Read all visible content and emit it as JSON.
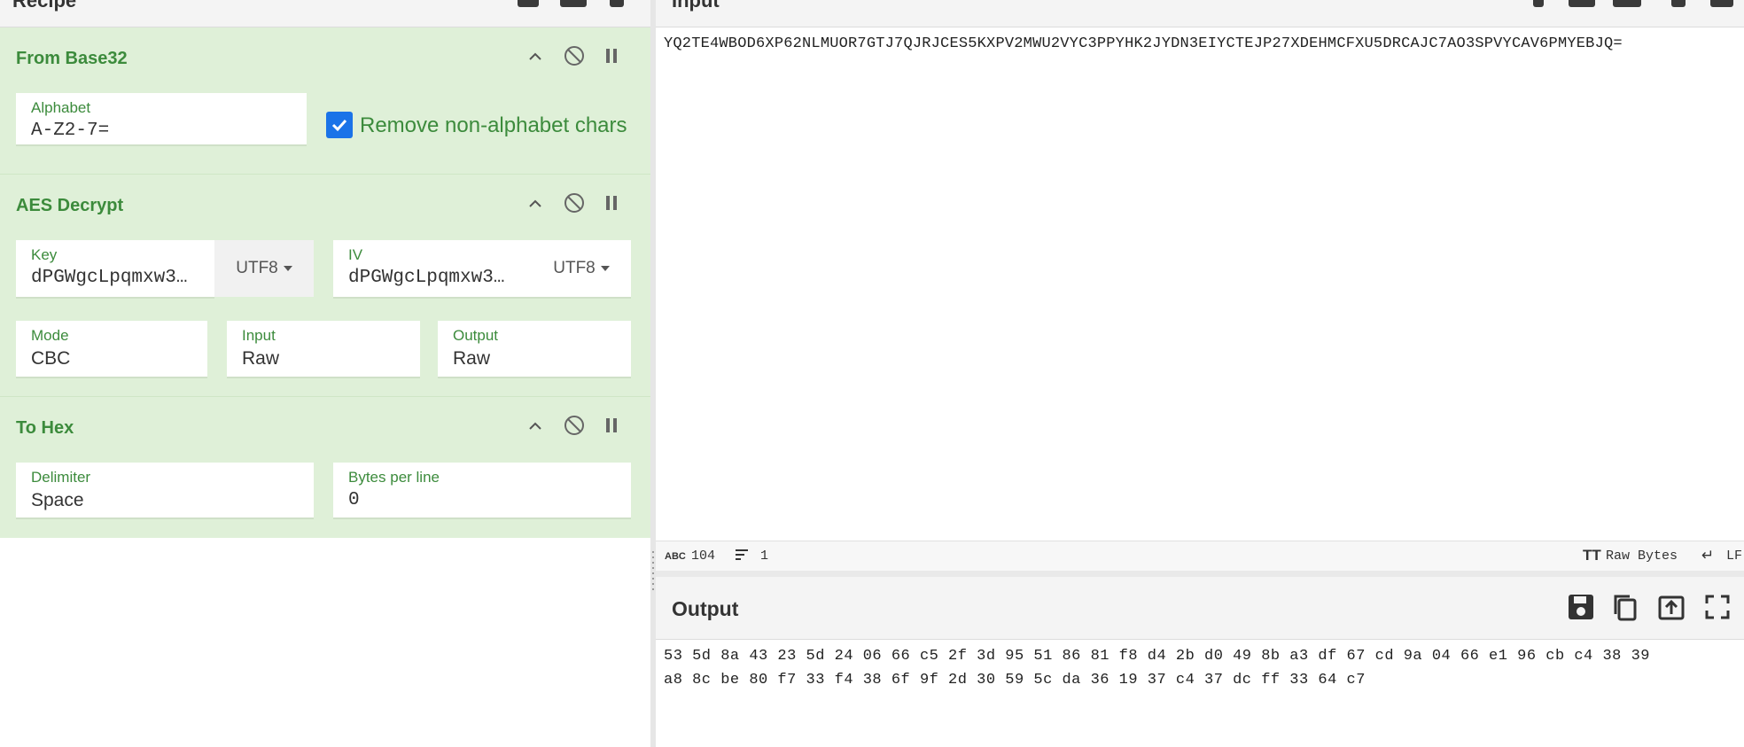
{
  "recipe": {
    "title": "Recipe",
    "operations": [
      {
        "name": "From Base32",
        "alphabet_label": "Alphabet",
        "alphabet_value": "A-Z2-7=",
        "remove_label": "Remove non-alphabet chars",
        "remove_checked": true
      },
      {
        "name": "AES Decrypt",
        "key_label": "Key",
        "key_value": "dPGWgcLpqmxw3…",
        "key_encoding": "UTF8",
        "iv_label": "IV",
        "iv_value": "dPGWgcLpqmxw3…",
        "iv_encoding": "UTF8",
        "mode_label": "Mode",
        "mode_value": "CBC",
        "input_label": "Input",
        "input_value": "Raw",
        "output_label": "Output",
        "output_value": "Raw"
      },
      {
        "name": "To Hex",
        "delimiter_label": "Delimiter",
        "delimiter_value": "Space",
        "bytes_label": "Bytes per line",
        "bytes_value": "0"
      }
    ]
  },
  "input": {
    "title": "Input",
    "text": "YQ2TE4WBOD6XP62NLMUOR7GTJ7QJRJCES5KXPV2MWU2VYC3PPYHK2JYDN3EIYCTEJP27XDEHMCFXU5DRCAJC7AO3SPVYCAV6PMYEBJQ=",
    "status": {
      "char_count": "104",
      "line_count": "1",
      "format": "Raw Bytes",
      "eol": "LF"
    }
  },
  "output": {
    "title": "Output",
    "lines": [
      "53 5d 8a 43 23 5d 24 06 66 c5 2f 3d 95 51 86 81 f8 d4 2b d0 49 8b a3 df 67 cd 9a 04 66 e1 96 cb c4 38 39",
      "a8 8c be 80 f7 33 f4 38 6f 9f 2d 30 59 5c da 36 19 37 c4 37 dc ff 33 64 c7"
    ]
  },
  "colors": {
    "recipe_bg": "#dff0d8",
    "accent_green": "#3c8b3c",
    "checkbox_blue": "#1a73e8"
  }
}
